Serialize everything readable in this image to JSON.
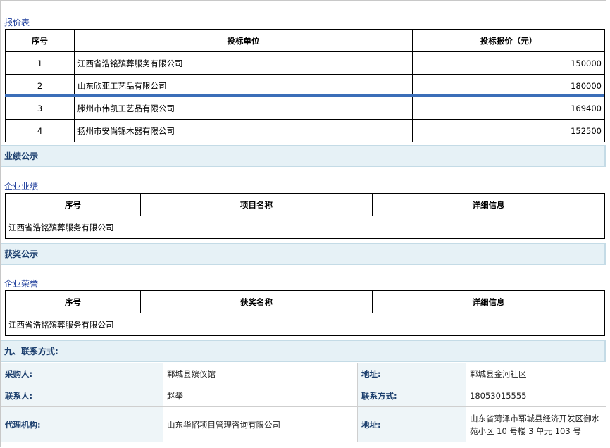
{
  "quote": {
    "label": "报价表",
    "headers": [
      "序号",
      "投标单位",
      "投标报价（元）"
    ],
    "rows": [
      {
        "no": "1",
        "company": "江西省浩铭殡葬服务有限公司",
        "price": "150000"
      },
      {
        "no": "2",
        "company": "山东欣亚工艺品有限公司",
        "price": "180000"
      },
      {
        "no": "3",
        "company": "滕州市伟凯工艺品有限公司",
        "price": "169400"
      },
      {
        "no": "4",
        "company": "扬州市安尚锦木器有限公司",
        "price": "152500"
      }
    ]
  },
  "performance": {
    "section_title": "业绩公示",
    "label": "企业业绩",
    "headers": [
      "序号",
      "项目名称",
      "详细信息"
    ],
    "company": "江西省浩铭殡葬服务有限公司"
  },
  "awards": {
    "section_title": "获奖公示",
    "label": "企业荣誉",
    "headers": [
      "序号",
      "获奖名称",
      "详细信息"
    ],
    "company": "江西省浩铭殡葬服务有限公司"
  },
  "contact": {
    "section_title": "九、联系方式:",
    "rows": [
      {
        "label1": "采购人:",
        "value1": "郓城县殡仪馆",
        "label2": "地址:",
        "value2": "郓城县金河社区"
      },
      {
        "label1": "联系人:",
        "value1": "赵举",
        "label2": "联系方式:",
        "value2": "18053015555"
      },
      {
        "label1": "代理机构:",
        "value1": "山东华招项目管理咨询有限公司",
        "label2": "地址:",
        "value2": "山东省菏泽市郓城县经济开发区御水苑小区 10 号楼 3 单元 103 号"
      }
    ]
  }
}
